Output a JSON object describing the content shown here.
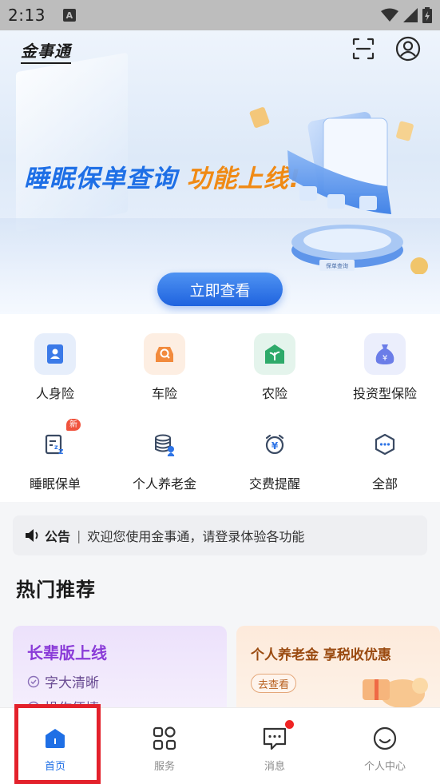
{
  "status_bar": {
    "time": "2:13",
    "notification_letter": "A",
    "icons": [
      "wifi-icon",
      "signal-icon",
      "battery-charging-icon"
    ]
  },
  "header": {
    "app_title": "金事通",
    "scan_icon": "scan-icon",
    "user_icon": "user-icon"
  },
  "banner": {
    "text_main": "睡眠保单查询",
    "text_highlight": "功能上线!",
    "cta_label": "立即查看",
    "illustration_caption": "保单查询"
  },
  "grid": {
    "items": [
      {
        "label": "人身险",
        "icon": "person-insurance-icon",
        "bg": "#e6eefb",
        "color": "#3b7ae8"
      },
      {
        "label": "车险",
        "icon": "car-insurance-icon",
        "bg": "#fdeee2",
        "color": "#f28a3c"
      },
      {
        "label": "农险",
        "icon": "agri-insurance-icon",
        "bg": "#e4f4ec",
        "color": "#2eaa6a"
      },
      {
        "label": "投资型保险",
        "icon": "money-bag-icon",
        "bg": "#ebeefc",
        "color": "#6b7de8"
      },
      {
        "label": "睡眠保单",
        "icon": "sleep-policy-icon",
        "badge": "新"
      },
      {
        "label": "个人养老金",
        "icon": "pension-coins-icon"
      },
      {
        "label": "交费提醒",
        "icon": "payment-alarm-icon"
      },
      {
        "label": "全部",
        "icon": "more-hexagon-icon"
      }
    ]
  },
  "notice": {
    "label": "公告",
    "separator": "|",
    "text": "欢迎您使用金事通，请登录体验各功能",
    "icon": "speaker-icon"
  },
  "hot": {
    "title": "热门推荐",
    "card_left": {
      "title": "长辈版上线",
      "features": [
        "字大清晰",
        "操作便捷"
      ]
    },
    "card_right": {
      "title": "个人养老金 享税收优惠",
      "button": "去查看"
    }
  },
  "bottom_nav": {
    "items": [
      {
        "label": "首页",
        "icon": "home-icon",
        "active": true
      },
      {
        "label": "服务",
        "icon": "grid-services-icon",
        "active": false
      },
      {
        "label": "消息",
        "icon": "message-icon",
        "active": false,
        "dot": true
      },
      {
        "label": "个人中心",
        "icon": "smile-profile-icon",
        "active": false
      }
    ]
  },
  "colors": {
    "primary": "#1f6fe5",
    "highlight_orange": "#f08a14",
    "annotation_red": "#e3212b"
  }
}
